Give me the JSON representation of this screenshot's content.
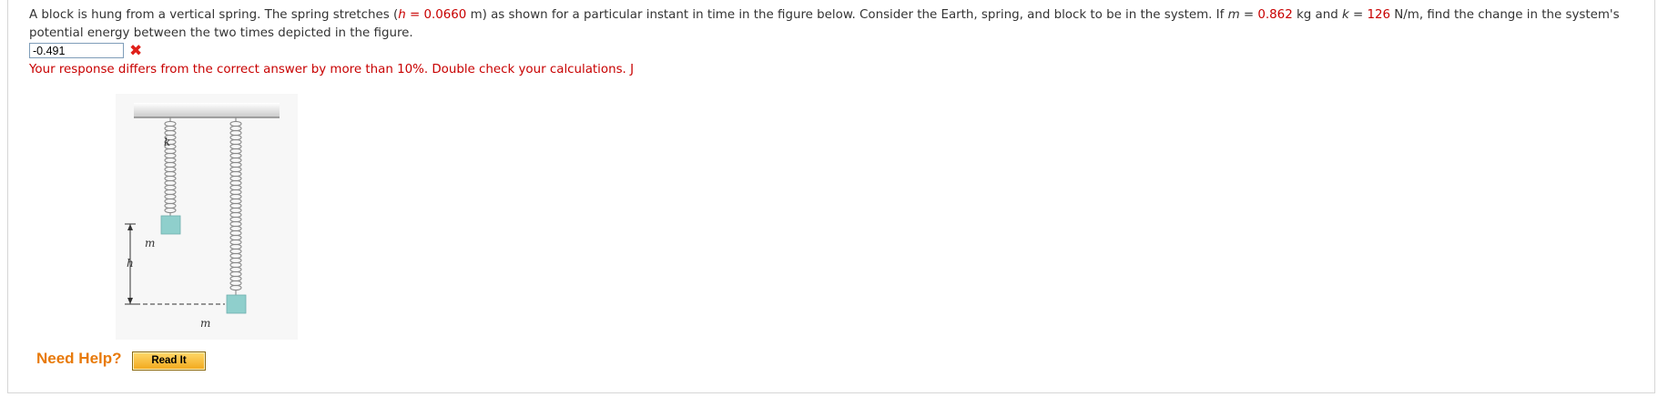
{
  "question": {
    "part1": "A block is hung from a vertical spring. The spring stretches  (",
    "h_var": "h",
    "h_eq": " = ",
    "h_value": "0.0660",
    "h_unit": " m)  as shown for a particular instant in time in the figure below. Consider the Earth, spring, and block to be in the system. If  ",
    "m_var": "m",
    "m_eq": " = ",
    "m_value": "0.862",
    "m_unit": " kg  and  ",
    "k_var": "k",
    "k_eq": " = ",
    "k_value": "126",
    "k_unit": " N/m,  find the change in the system's potential energy between the two times depicted in the figure."
  },
  "answer": {
    "value": "-0.491"
  },
  "feedback": "Your response differs from the correct answer by more than 10%. Double check your calculations. J",
  "figure": {
    "k_label": "k",
    "h_label": "h",
    "m_label_left": "m",
    "m_label_right": "m"
  },
  "help": {
    "need_help_label": "Need Help?",
    "read_it_label": "Read It"
  },
  "colors": {
    "accent_red": "#c80000",
    "help_orange": "#e87a0a",
    "block_teal": "#8fcfcc"
  },
  "icons": {
    "wrong": "red-x-icon"
  }
}
